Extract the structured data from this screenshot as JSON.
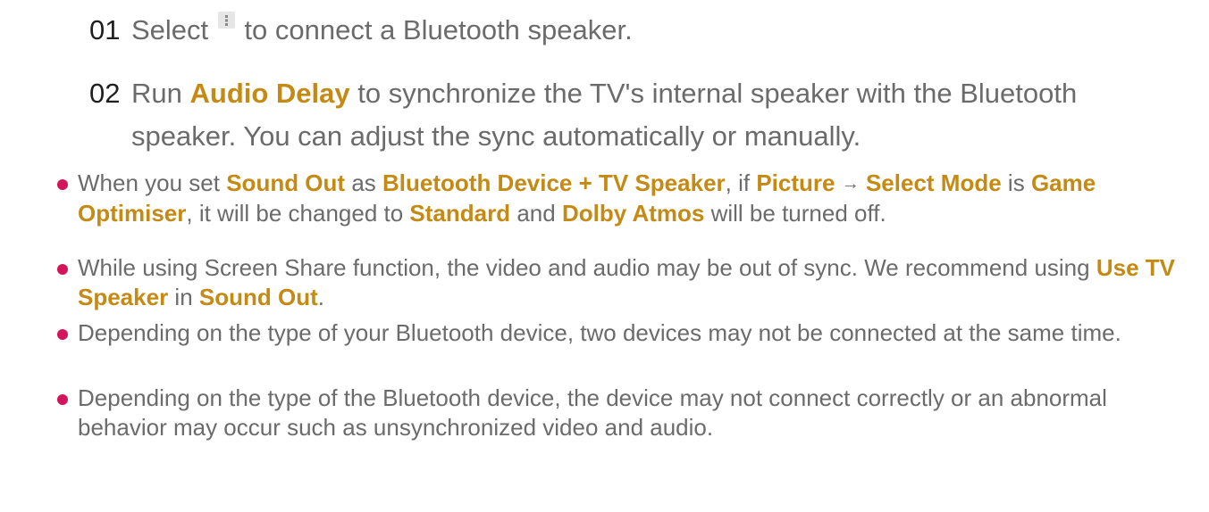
{
  "steps": [
    {
      "num": "01",
      "pre": "Select",
      "icon": "more-options-icon",
      "post": "to connect a Bluetooth speaker."
    },
    {
      "num": "02",
      "pre": "Run",
      "bold": "Audio Delay",
      "post": "to synchronize the TV's internal speaker with the Bluetooth speaker. You can adjust the sync automatically or manually."
    }
  ],
  "notes": [
    {
      "t1": "When you set",
      "b1": "Sound Out",
      "t2": "as",
      "b2": "Bluetooth Device + TV Speaker",
      "t3": ", if",
      "b3": "Picture",
      "arrow": "→",
      "b4": "Select Mode",
      "t4": "is",
      "b5": "Game Optimiser",
      "t5": ", it will be changed to",
      "b6": "Standard",
      "t6": "and",
      "b7": "Dolby Atmos",
      "t7": "will be turned off."
    },
    {
      "t1": "While using Screen Share function, the video and audio may be out of sync. We recommend using",
      "b1": "Use TV Speaker",
      "t2": "in",
      "b2": "Sound Out",
      "t3": "."
    },
    {
      "t1": "Depending on the type of your Bluetooth device, two devices may not be connected at the same time."
    },
    {
      "t1": "Depending on the type of the Bluetooth device, the device may not connect correctly or an abnormal behavior may occur such as unsynchronized video and audio."
    }
  ],
  "colors": {
    "highlight": "#c48a14",
    "bullet": "#d4145a",
    "body_text": "#6b6b6b",
    "step_number": "#1f1f1f"
  }
}
